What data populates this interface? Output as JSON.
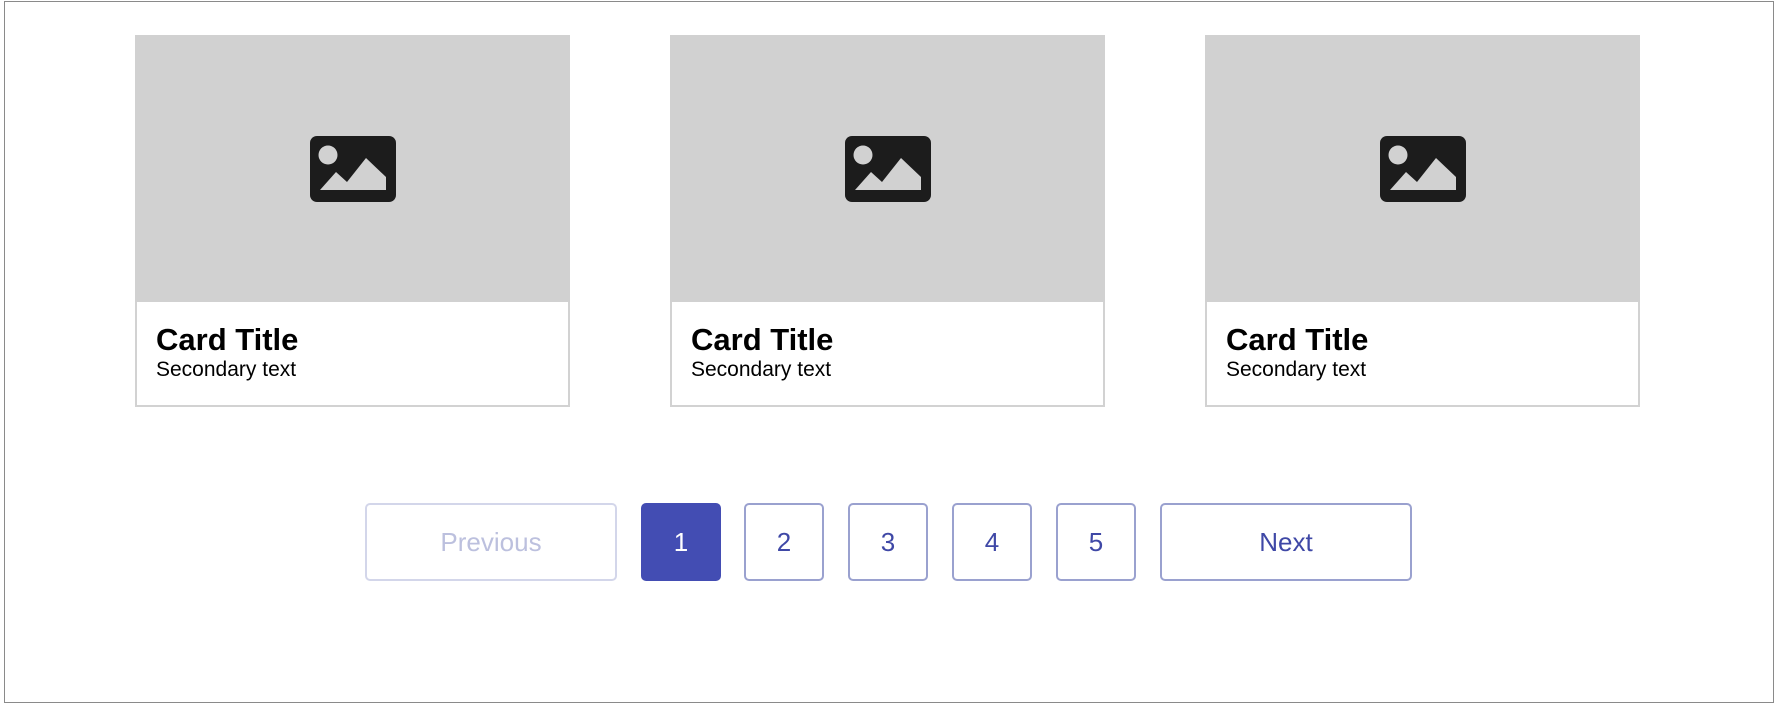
{
  "cards": [
    {
      "icon": "image-placeholder-icon",
      "title": "Card Title",
      "subtitle": "Secondary text"
    },
    {
      "icon": "image-placeholder-icon",
      "title": "Card Title",
      "subtitle": "Secondary text"
    },
    {
      "icon": "image-placeholder-icon",
      "title": "Card Title",
      "subtitle": "Secondary text"
    }
  ],
  "pagination": {
    "previous_label": "Previous",
    "next_label": "Next",
    "pages": [
      "1",
      "2",
      "3",
      "4",
      "5"
    ],
    "current_page": "1",
    "previous_disabled": true
  },
  "colors": {
    "accent": "#434db3",
    "accent_text": "#3f48a6",
    "button_border": "#9aa1cf",
    "disabled_border": "#d3d6ea",
    "disabled_text": "#bcc0de",
    "media_background": "#d1d1d1",
    "card_border": "#d2d2d2",
    "icon": "#1c1c1c"
  }
}
